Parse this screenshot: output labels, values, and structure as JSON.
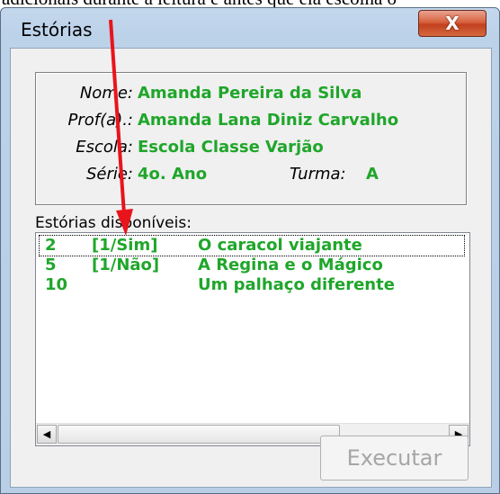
{
  "caption": "adicionais durante a leitura e antes que ela escolha o",
  "window": {
    "title": "Estórias",
    "close_glyph": "X"
  },
  "info": {
    "nome_label": "Nome:",
    "nome_value": "Amanda Pereira da Silva",
    "prof_label": "Prof(a).:",
    "prof_value": "Amanda Lana Diniz Carvalho",
    "escola_label": "Escola:",
    "escola_value": "Escola Classe Varjão",
    "serie_label": "Série:",
    "serie_value": "4o. Ano",
    "turma_label": "Turma:",
    "turma_value": "A"
  },
  "list": {
    "label": "Estórias disponíveis:",
    "items": [
      {
        "id": "2",
        "status": "[1/Sim]",
        "title": "O caracol viajante"
      },
      {
        "id": "5",
        "status": "[1/Não]",
        "title": "A Regina e o Mágico"
      },
      {
        "id": "10",
        "status": "",
        "title": "Um palhaço diferente"
      }
    ],
    "selected_index": 0
  },
  "buttons": {
    "execute_label": "Executar"
  },
  "colors": {
    "value_green": "#1fa62a",
    "arrow_red": "#e8141c",
    "window_frame": "#b9cfe6"
  }
}
